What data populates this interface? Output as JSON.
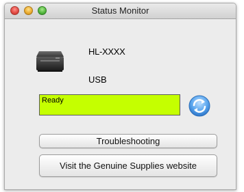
{
  "window": {
    "title": "Status Monitor"
  },
  "device": {
    "model": "HL-XXXX",
    "connection": "USB",
    "icon": "printer-icon"
  },
  "status": {
    "text": "Ready",
    "color": "#c5ff00"
  },
  "refresh": {
    "icon": "refresh-icon",
    "color": "#3a8fe0"
  },
  "buttons": {
    "troubleshooting": "Troubleshooting",
    "supplies": "Visit the Genuine Supplies website"
  }
}
